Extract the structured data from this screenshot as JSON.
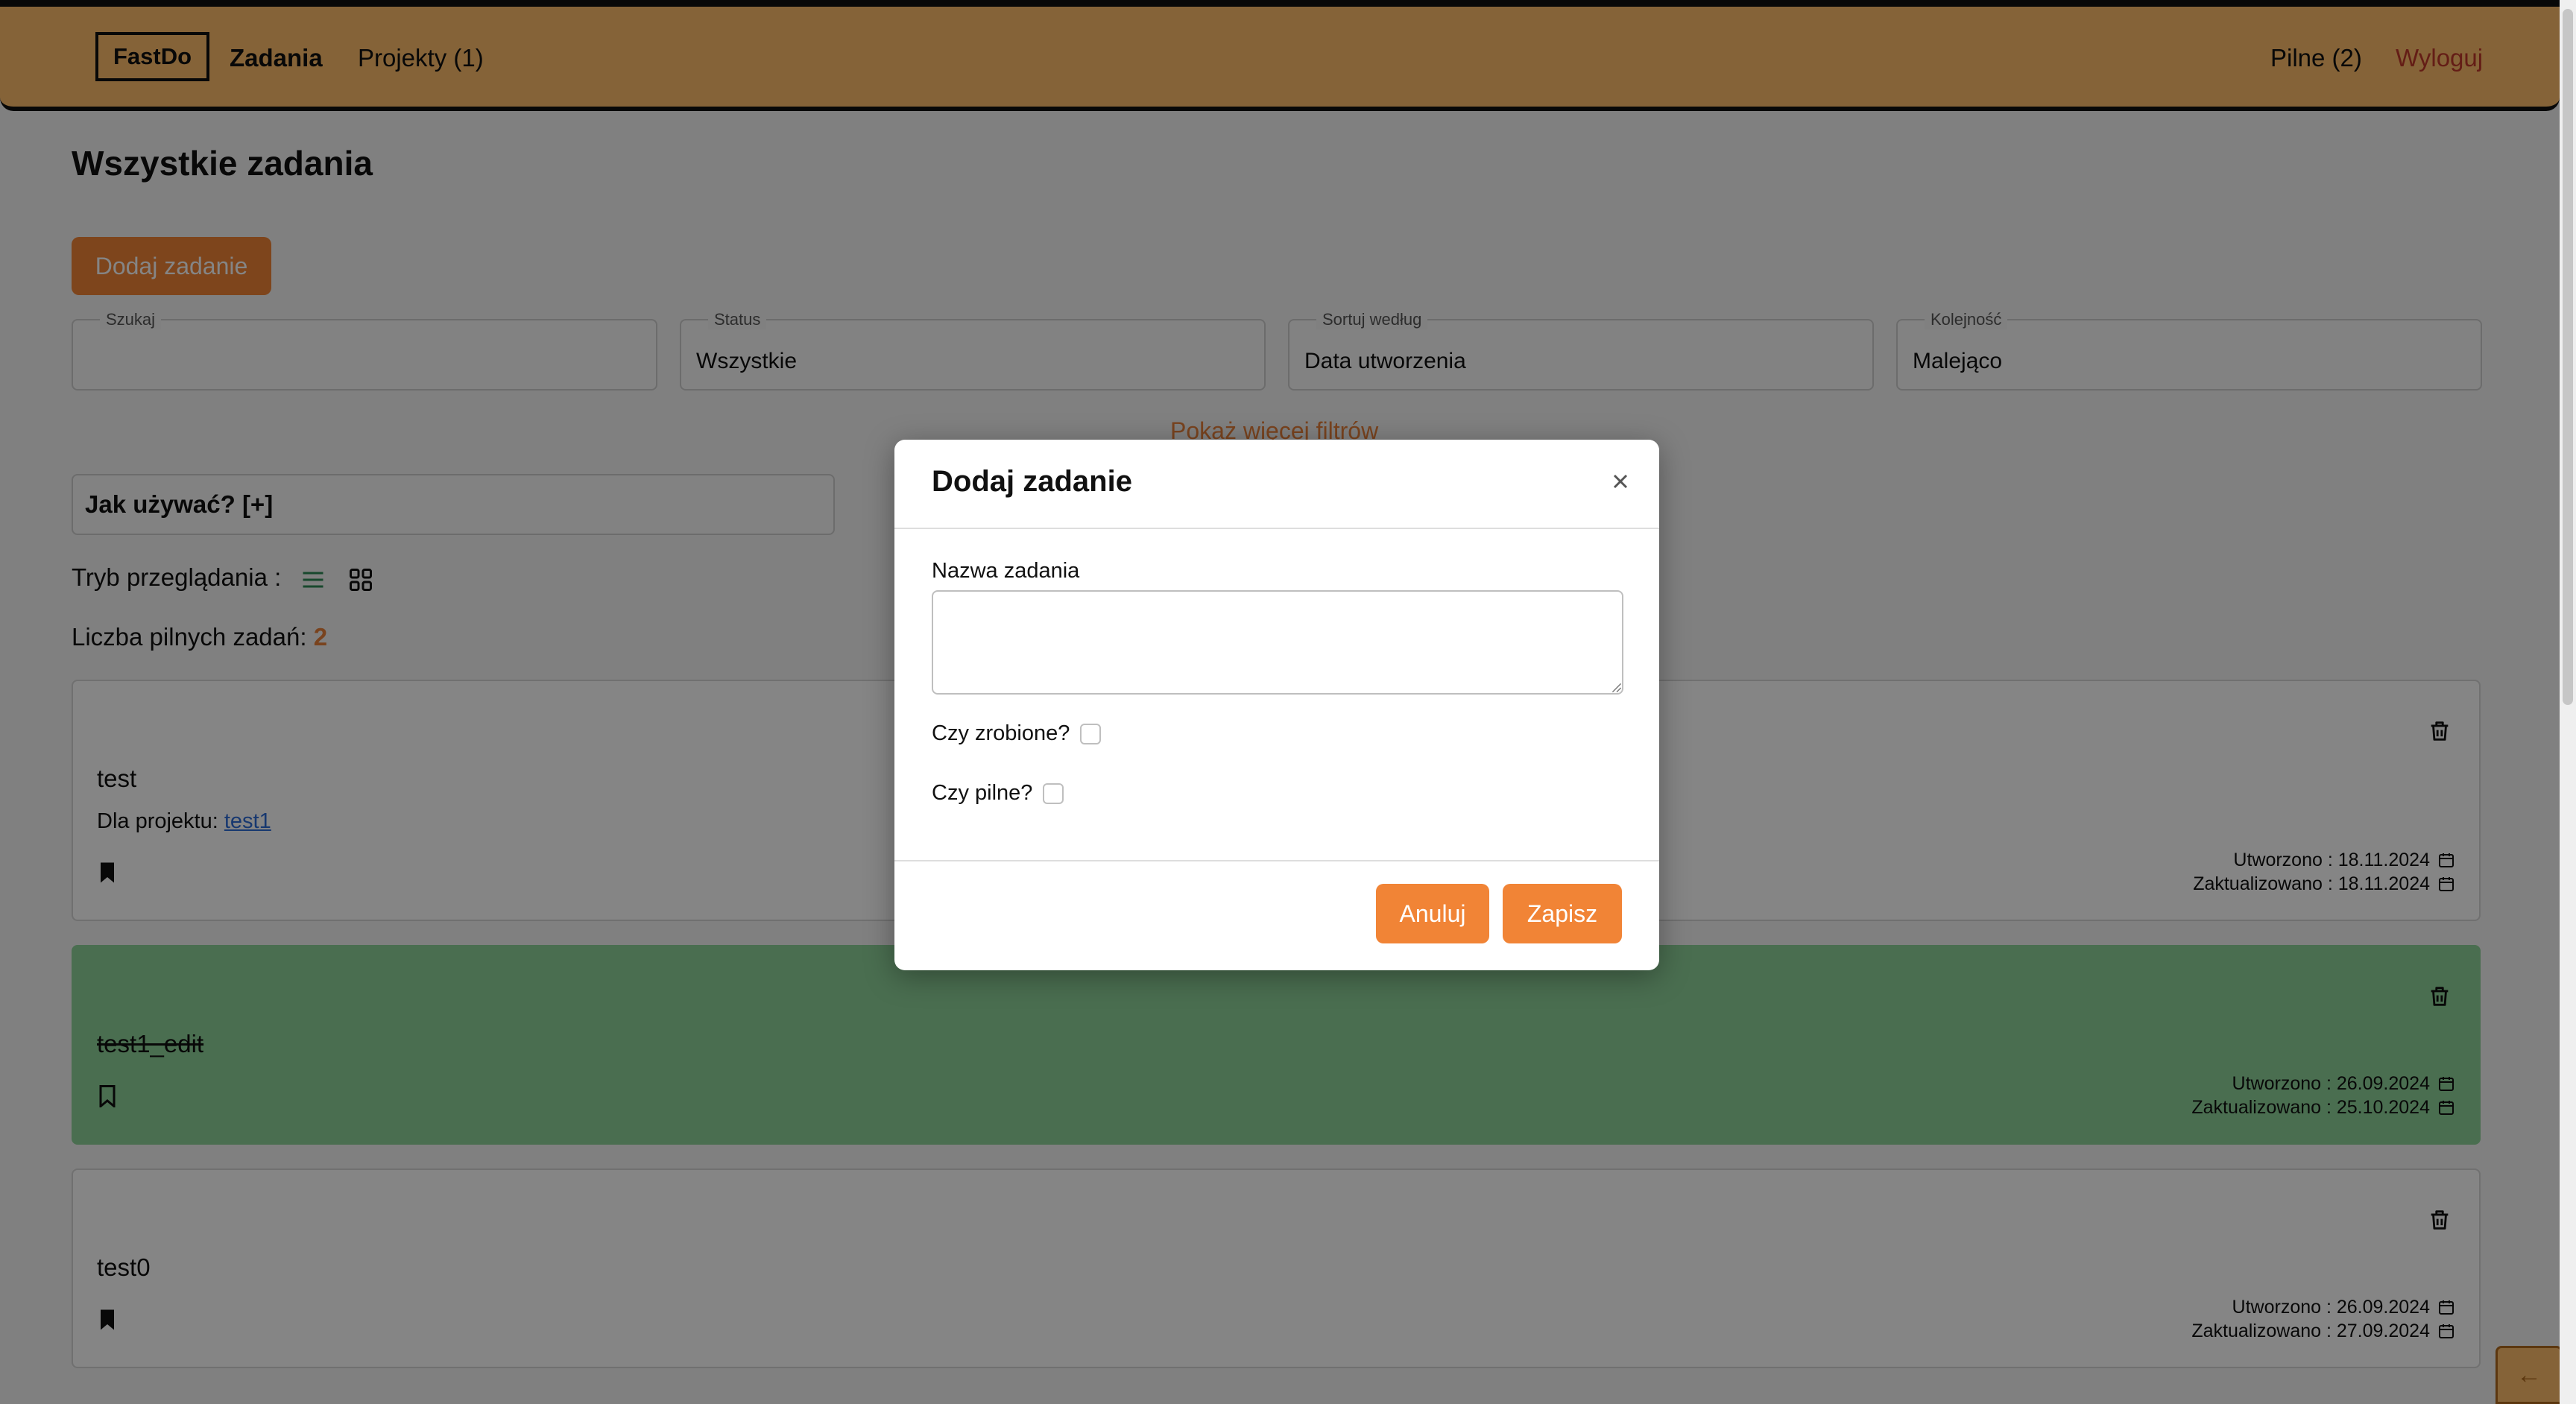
{
  "nav": {
    "brand": "FastDo",
    "tasks": "Zadania",
    "projects": "Projekty (1)",
    "urgent": "Pilne (2)",
    "logout": "Wyloguj"
  },
  "page": {
    "title": "Wszystkie zadania",
    "add_button": "Dodaj zadanie",
    "more_filters": "Pokaż więcej filtrów",
    "howto": "Jak używać? [+]",
    "view_mode_label": "Tryb przeglądania :",
    "urgent_count_label": "Liczba pilnych zadań:",
    "urgent_count_value": "2"
  },
  "filters": [
    {
      "label": "Szukaj",
      "value": ""
    },
    {
      "label": "Status",
      "value": "Wszystkie"
    },
    {
      "label": "Sortuj według",
      "value": "Data utworzenia"
    },
    {
      "label": "Kolejność",
      "value": "Malejąco"
    }
  ],
  "tasks": [
    {
      "title": "test",
      "project_label": "Dla projektu:",
      "project_link": "test1",
      "created": "Utworzono : 18.11.2024",
      "updated": "Zaktualizowano : 18.11.2024",
      "done": false,
      "urgent": true
    },
    {
      "title": "test1_edit",
      "created": "Utworzono : 26.09.2024",
      "updated": "Zaktualizowano : 25.10.2024",
      "done": true,
      "urgent": false
    },
    {
      "title": "test0",
      "created": "Utworzono : 26.09.2024",
      "updated": "Zaktualizowano : 27.09.2024",
      "done": false,
      "urgent": true
    }
  ],
  "modal": {
    "title": "Dodaj zadanie",
    "name_label": "Nazwa zadania",
    "name_value": "",
    "done_label": "Czy zrobione?",
    "urgent_label": "Czy pilne?",
    "cancel": "Anuluj",
    "save": "Zapisz"
  },
  "colors": {
    "navbar": "#ffbe6b",
    "accent": "#f18436",
    "done_task": "#8fd49a",
    "logout": "#c0392b"
  },
  "icons": [
    "trash-icon",
    "bookmark-icon",
    "calendar-icon",
    "list-view-icon",
    "grid-view-icon",
    "close-icon",
    "arrow-left-icon"
  ]
}
